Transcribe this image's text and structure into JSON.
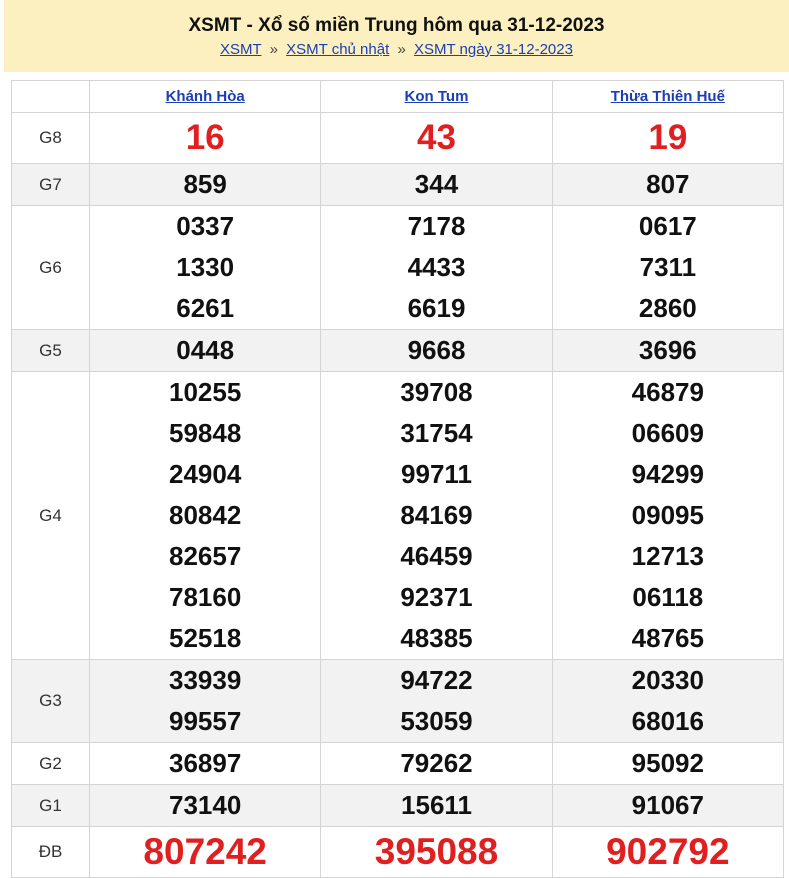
{
  "header": {
    "title": "XSMT - Xổ số miền Trung hôm qua 31-12-2023",
    "breadcrumb": [
      {
        "label": "XSMT"
      },
      {
        "label": "XSMT chủ nhật"
      },
      {
        "label": "XSMT ngày 31-12-2023"
      }
    ],
    "separator": "»"
  },
  "provinces": [
    "Khánh Hòa",
    "Kon Tum",
    "Thừa Thiên Huế"
  ],
  "rows": [
    {
      "prize": "G8",
      "values": [
        [
          "16"
        ],
        [
          "43"
        ],
        [
          "19"
        ]
      ]
    },
    {
      "prize": "G7",
      "values": [
        [
          "859"
        ],
        [
          "344"
        ],
        [
          "807"
        ]
      ]
    },
    {
      "prize": "G6",
      "values": [
        [
          "0337",
          "1330",
          "6261"
        ],
        [
          "7178",
          "4433",
          "6619"
        ],
        [
          "0617",
          "7311",
          "2860"
        ]
      ]
    },
    {
      "prize": "G5",
      "values": [
        [
          "0448"
        ],
        [
          "9668"
        ],
        [
          "3696"
        ]
      ]
    },
    {
      "prize": "G4",
      "values": [
        [
          "10255",
          "59848",
          "24904",
          "80842",
          "82657",
          "78160",
          "52518"
        ],
        [
          "39708",
          "31754",
          "99711",
          "84169",
          "46459",
          "92371",
          "48385"
        ],
        [
          "46879",
          "06609",
          "94299",
          "09095",
          "12713",
          "06118",
          "48765"
        ]
      ]
    },
    {
      "prize": "G3",
      "values": [
        [
          "33939",
          "99557"
        ],
        [
          "94722",
          "53059"
        ],
        [
          "20330",
          "68016"
        ]
      ]
    },
    {
      "prize": "G2",
      "values": [
        [
          "36897"
        ],
        [
          "79262"
        ],
        [
          "95092"
        ]
      ]
    },
    {
      "prize": "G1",
      "values": [
        [
          "73140"
        ],
        [
          "15611"
        ],
        [
          "91067"
        ]
      ]
    },
    {
      "prize": "ĐB",
      "values": [
        [
          "807242"
        ],
        [
          "395088"
        ],
        [
          "902792"
        ]
      ]
    }
  ]
}
